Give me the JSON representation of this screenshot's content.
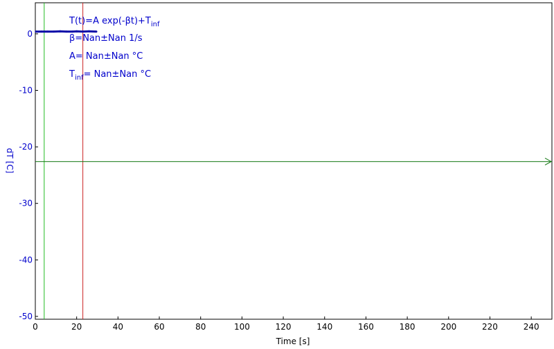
{
  "chart_data": {
    "type": "line",
    "title": "",
    "xlabel": "Time [s]",
    "ylabel": "dT [C]",
    "xlim": [
      0,
      250
    ],
    "ylim": [
      -50.5,
      5.5
    ],
    "x_ticks": [
      0,
      20,
      40,
      60,
      80,
      100,
      120,
      140,
      160,
      180,
      200,
      220,
      240
    ],
    "y_ticks": [
      0,
      -10,
      -20,
      -30,
      -40,
      -50
    ],
    "grid": false,
    "series": [
      {
        "color": "#0a0aa8",
        "x": [
          0.3,
          3,
          6,
          9,
          12,
          15,
          18,
          20,
          23,
          26,
          29.5
        ],
        "y": [
          0.4,
          0.4,
          0.4,
          0.4,
          0.45,
          0.4,
          0.4,
          0.45,
          0.4,
          0.45,
          0.4
        ]
      }
    ],
    "markers": {
      "green_vertical_x": 4.3,
      "red_vertical_x": 23,
      "horizontal_arrow_y": -22.6
    },
    "annotations": {
      "formula": {
        "text": "T(t)=A exp(-βt)+T",
        "sub": "inf"
      },
      "beta": {
        "text": "β=Nan±Nan 1/s"
      },
      "amplitude": {
        "text": "A= Nan±Nan °C"
      },
      "tinf": {
        "prefix": "T",
        "sub": "inf",
        "text": "= Nan±Nan °C"
      }
    },
    "colors": {
      "axis_text": "#0000cc",
      "data": "#0a0aa8",
      "green_line": "#22bb22",
      "red_line": "#cc2222",
      "arrow": "#117711"
    }
  }
}
